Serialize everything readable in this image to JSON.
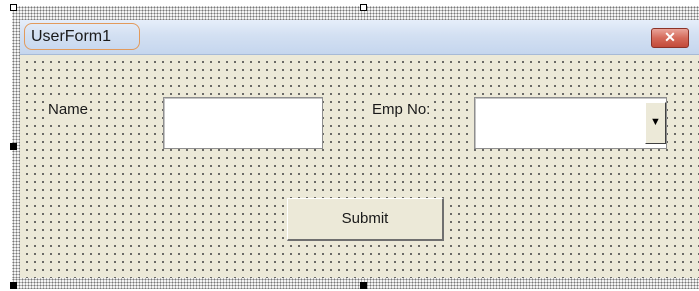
{
  "window": {
    "title": "UserForm1",
    "close_glyph": "✕",
    "title_highlight_color": "#e29a5c",
    "close_color": "#d56a5a"
  },
  "form": {
    "name_label": "Name",
    "name_value": "",
    "emp_label": "Emp No:",
    "emp_value": "",
    "dropdown_icon": "dropdown-arrow-icon",
    "submit_label": "Submit"
  }
}
